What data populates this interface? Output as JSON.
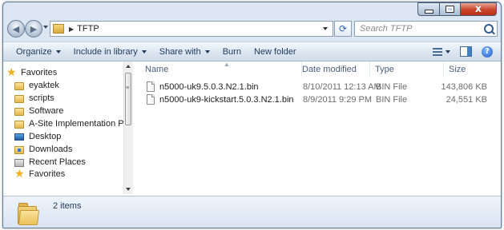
{
  "window": {
    "caption_buttons": {
      "minimize": "",
      "maximize": "",
      "close": "x"
    }
  },
  "address_bar": {
    "path": [
      "TFTP"
    ],
    "search_placeholder": "Search TFTP"
  },
  "toolbar": {
    "items": [
      {
        "label": "Organize",
        "dropdown": true
      },
      {
        "label": "Include in library",
        "dropdown": true
      },
      {
        "label": "Share with",
        "dropdown": true
      },
      {
        "label": "Burn",
        "dropdown": false
      },
      {
        "label": "New folder",
        "dropdown": false
      }
    ]
  },
  "nav_pane": {
    "items": [
      {
        "label": "Favorites",
        "icon": "star-icon"
      },
      {
        "label": "eyaktek",
        "icon": "folder-icon"
      },
      {
        "label": "scripts",
        "icon": "folder-icon"
      },
      {
        "label": "Software",
        "icon": "folder-icon"
      },
      {
        "label": "A-Site Implementation Plan",
        "icon": "folder-icon"
      },
      {
        "label": "Desktop",
        "icon": "desktop-icon"
      },
      {
        "label": "Downloads",
        "icon": "downloads-icon"
      },
      {
        "label": "Recent Places",
        "icon": "recent-places-icon"
      },
      {
        "label": "Favorites",
        "icon": "star-icon"
      }
    ]
  },
  "file_list": {
    "columns": [
      "Name",
      "Date modified",
      "Type",
      "Size"
    ],
    "rows": [
      {
        "name": "n5000-uk9.5.0.3.N2.1.bin",
        "date": "8/10/2011 12:13 AM",
        "type": "BIN File",
        "size": "143,806 KB"
      },
      {
        "name": "n5000-uk9-kickstart.5.0.3.N2.1.bin",
        "date": "8/9/2011 9:29 PM",
        "type": "BIN File",
        "size": "24,551 KB"
      }
    ]
  },
  "status_bar": {
    "item_count": "2 items"
  },
  "colors": {
    "accent": "#1e395b",
    "window_frame": "#dbe6f2",
    "close_button": "#c8442a"
  }
}
